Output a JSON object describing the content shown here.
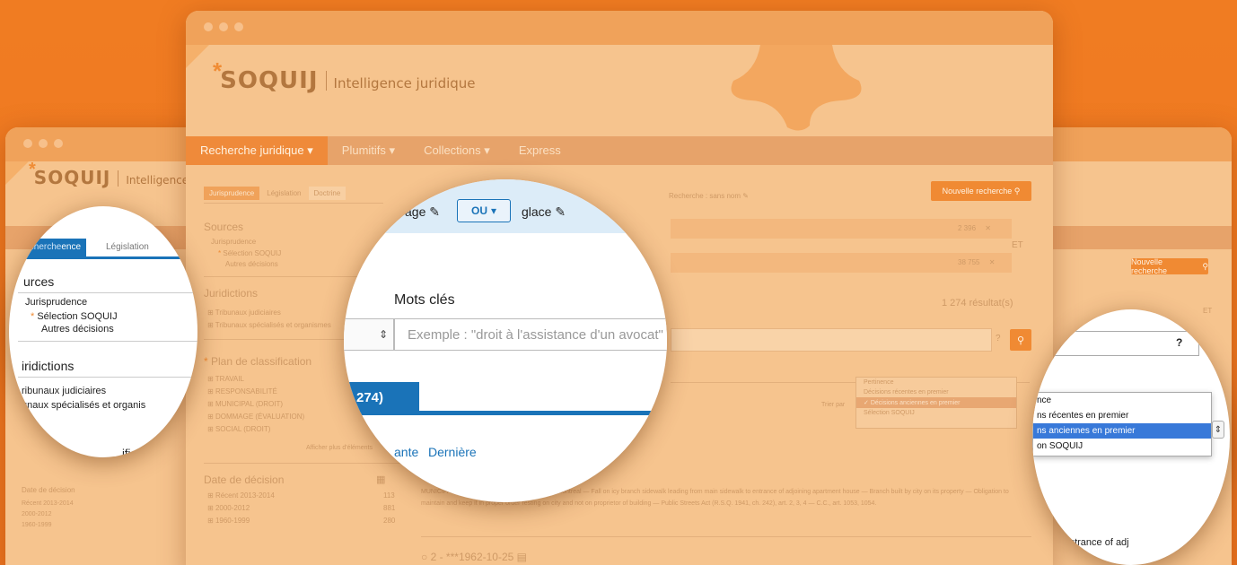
{
  "colors": {
    "background": "#ee7520",
    "accent": "#1a73b8",
    "window": "#f6c48e",
    "nav": "#e7a36a",
    "orange_button": "#f08a33"
  },
  "brand": {
    "star": "*",
    "name": "SOQUIJ",
    "tagline": "Intelligence juridique"
  },
  "nav": {
    "items": [
      {
        "label": "Recherche juridique",
        "caret": "▾"
      },
      {
        "label": "Plumitifs",
        "caret": "▾"
      },
      {
        "label": "Collections",
        "caret": "▾"
      },
      {
        "label": "Express",
        "caret": ""
      }
    ]
  },
  "main": {
    "tabs": [
      "Jurisprudence",
      "Législation",
      "Doctrine"
    ],
    "new_search": "Nouvelle recherche",
    "search_label": "Recherche : sans nom",
    "sources": {
      "title": "Sources",
      "group": "Jurisprudence",
      "items": [
        "Sélection SOQUIJ",
        "Autres décisions"
      ]
    },
    "jurisdictions": {
      "title": "Juridictions",
      "items": [
        "Tribunaux judiciaires",
        "Tribunaux spécialisés et organismes"
      ]
    },
    "classification": {
      "title": "Plan de classification",
      "items": [
        "TRAVAIL",
        "RESPONSABILITÉ",
        "MUNICIPAL (DROIT)",
        "DOMMAGE (ÉVALUATION)",
        "SOCIAL (DROIT)"
      ],
      "show_more": "Afficher plus d'éléments"
    },
    "decision_date": {
      "title": "Date de décision",
      "rows": [
        {
          "label": "Récent 2013-2014",
          "count": "113"
        },
        {
          "label": "2000-2012",
          "count": "881"
        },
        {
          "label": "1960-1999",
          "count": "280"
        }
      ]
    },
    "criteria": [
      {
        "count": "2 396"
      },
      {
        "count": "38 755"
      }
    ],
    "et": "ET",
    "results": "1 274 résultat(s)",
    "sort_label": "Trier par",
    "sort_options": [
      "Pertinence",
      "Décisions récentes en premier",
      "Décisions anciennes en premier",
      "Sélection SOQUIJ"
    ],
    "snippet": "MUNICIPAL (DROIT) — Municipal law — City of Montreal — Fall on icy branch sidewalk leading from main sidewalk to entrance of adjoining apartment house — Branch built by city on its property — Obligation to maintain and keep it in proper order resting on city and not on proprietor of building — Public Streets Act (R.S.Q. 1941, ch. 242), art. 2, 3, 4 — C.C., art. 1053, 1054.",
    "next_item": "2 - ***1962-10-25"
  },
  "lens_main": {
    "term_before": "age",
    "operator": "OU",
    "term_after": "glace",
    "keywords_label": "Mots clés",
    "placeholder": "Exemple : \"droit à l'assistance d'un avocat\"",
    "tab_count": "274)",
    "pager_prev": "ante",
    "pager_last": "Dernière"
  },
  "lens_left": {
    "tab_active": "Recherche",
    "tab_active_suffix": "ence",
    "tab_other": "Législation",
    "sources_title": "urces",
    "group": "Jurisprudence",
    "items": [
      "Sélection SOQUIJ",
      "Autres décisions"
    ],
    "jurisdictions_title": "iridictions",
    "jur_items": [
      "ribunaux judiciaires",
      "unaux spécialisés et organis"
    ],
    "classification_title": "ification"
  },
  "lens_right": {
    "help": "?",
    "options": [
      "nce",
      "ns récentes en premier",
      "ns anciennes en premier",
      "on SOQUIJ"
    ],
    "snippet": "valk to entrance of adj"
  }
}
